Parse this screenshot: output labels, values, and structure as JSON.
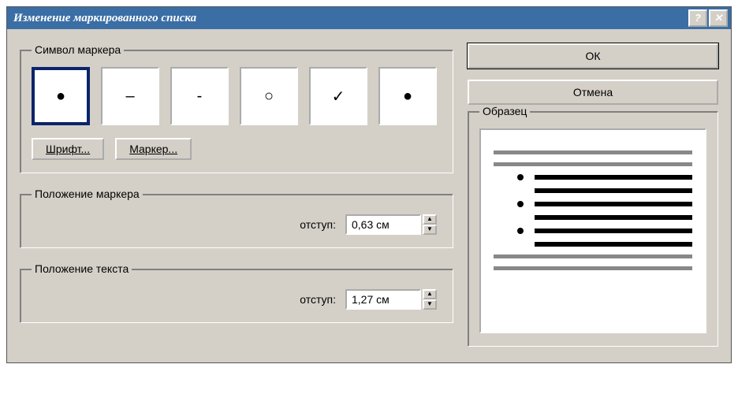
{
  "window": {
    "title": "Изменение маркированного списка"
  },
  "groups": {
    "bullet_symbol": "Символ маркера",
    "marker_position": "Положение маркера",
    "text_position": "Положение текста",
    "preview": "Образец"
  },
  "buttons": {
    "font": "Шрифт...",
    "marker": "Маркер...",
    "ok": "ОК",
    "cancel": "Отмена"
  },
  "labels": {
    "indent": "отступ:"
  },
  "values": {
    "marker_indent": "0,63 см",
    "text_indent": "1,27 см"
  },
  "bullets": {
    "selected_index": 0,
    "glyphs": [
      "●",
      "–",
      "-",
      "○",
      "✓",
      "●"
    ]
  }
}
